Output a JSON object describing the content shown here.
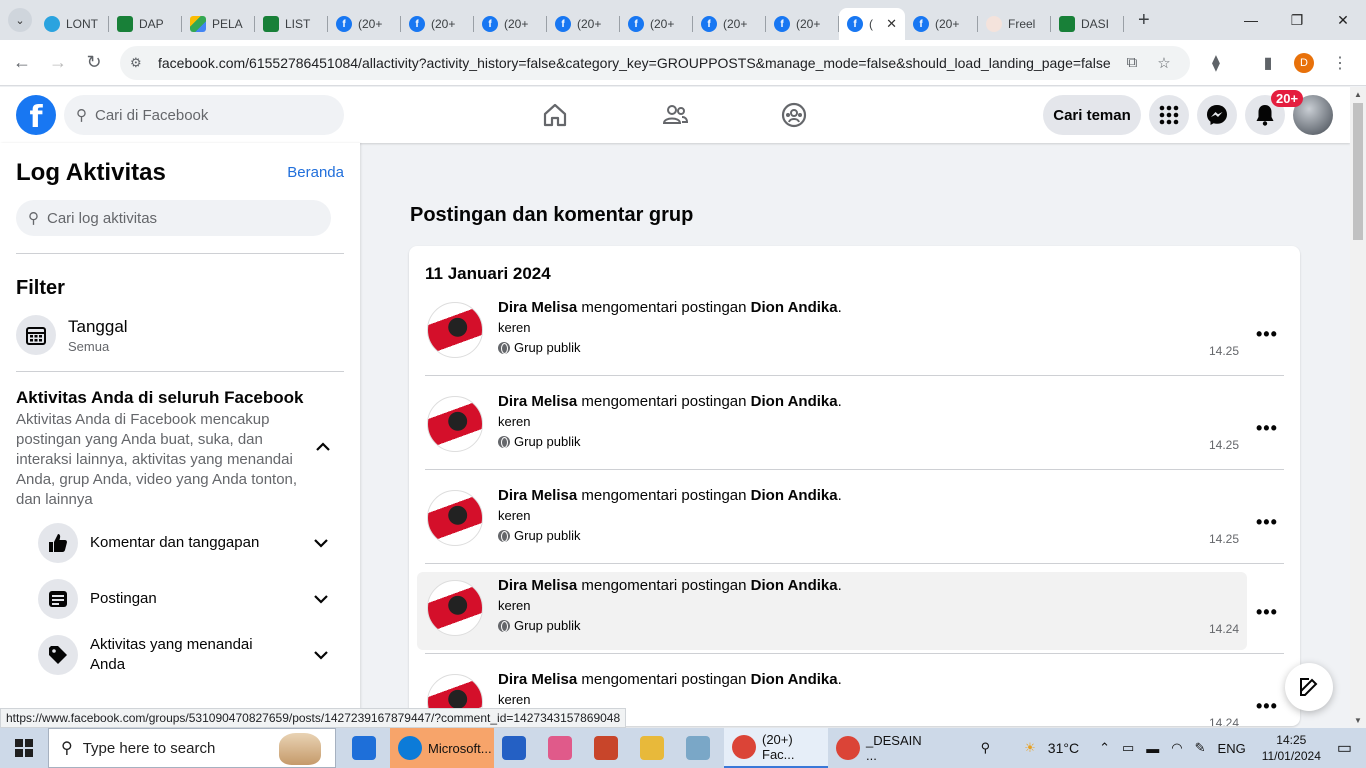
{
  "browser": {
    "tabs": [
      {
        "label": "LONT",
        "fav": "tg",
        "icon": "telegram-icon"
      },
      {
        "label": "DAP",
        "fav": "sh",
        "icon": "sheets-icon"
      },
      {
        "label": "PELA",
        "fav": "dr",
        "icon": "drive-icon"
      },
      {
        "label": "LIST",
        "fav": "sh",
        "icon": "sheets-icon"
      },
      {
        "label": "(20+",
        "fav": "fb",
        "icon": "facebook-icon"
      },
      {
        "label": "(20+",
        "fav": "fb",
        "icon": "facebook-icon"
      },
      {
        "label": "(20+",
        "fav": "fb",
        "icon": "facebook-icon"
      },
      {
        "label": "(20+",
        "fav": "fb",
        "icon": "facebook-icon"
      },
      {
        "label": "(20+",
        "fav": "fb",
        "icon": "facebook-icon"
      },
      {
        "label": "(20+",
        "fav": "fb",
        "icon": "facebook-icon"
      },
      {
        "label": "(20+",
        "fav": "fb",
        "icon": "facebook-icon"
      },
      {
        "label": "(",
        "fav": "fb",
        "icon": "facebook-icon",
        "active": true
      },
      {
        "label": "(20+",
        "fav": "fb",
        "icon": "facebook-icon"
      },
      {
        "label": "Freel",
        "fav": "fr",
        "icon": "freelance-icon"
      },
      {
        "label": "DASI",
        "fav": "sh",
        "icon": "sheets-icon"
      }
    ],
    "url": "facebook.com/61552786451084/allactivity?activity_history=false&category_key=GROUPPOSTS&manage_mode=false&should_load_landing_page=false",
    "profile_initial": "D",
    "status_url": "https://www.facebook.com/groups/531090470827659/posts/1427239167879447/?comment_id=1427343157869048"
  },
  "fbnav": {
    "search_placeholder": "Cari di Facebook",
    "find_friends": "Cari teman",
    "notif_badge": "20+"
  },
  "sidebar": {
    "title": "Log Aktivitas",
    "home_link": "Beranda",
    "search_placeholder": "Cari log aktivitas",
    "filter_title": "Filter",
    "filter_item": {
      "label": "Tanggal",
      "sub": "Semua"
    },
    "activity_title": "Aktivitas Anda di seluruh Facebook",
    "activity_desc": "Aktivitas Anda di Facebook mencakup postingan yang Anda buat, suka, dan interaksi lainnya, aktivitas yang menandai Anda, grup Anda, video yang Anda tonton, dan lainnya",
    "categories": [
      {
        "label": "Komentar dan tanggapan",
        "icon": "like-icon"
      },
      {
        "label": "Postingan",
        "icon": "post-icon"
      },
      {
        "label": "Aktivitas yang menandai Anda",
        "icon": "tag-icon"
      }
    ]
  },
  "main": {
    "title": "Postingan dan komentar grup",
    "date": "11 Januari 2024",
    "entries": [
      {
        "actor": "Dira Melisa",
        "verb": " mengomentari postingan ",
        "target": "Dion Andika",
        "end": ".",
        "comment": "keren",
        "audience": "Grup publik",
        "time": "14.25"
      },
      {
        "actor": "Dira Melisa",
        "verb": " mengomentari postingan ",
        "target": "Dion Andika",
        "end": ".",
        "comment": "keren",
        "audience": "Grup publik",
        "time": "14.25"
      },
      {
        "actor": "Dira Melisa",
        "verb": " mengomentari postingan ",
        "target": "Dion Andika",
        "end": ".",
        "comment": "keren",
        "audience": "Grup publik",
        "time": "14.25"
      },
      {
        "actor": "Dira Melisa",
        "verb": " mengomentari postingan ",
        "target": "Dion Andika",
        "end": ".",
        "comment": "keren",
        "audience": "Grup publik",
        "time": "14.24"
      },
      {
        "actor": "Dira Melisa",
        "verb": " mengomentari postingan ",
        "target": "Dion Andika",
        "end": ".",
        "comment": "keren",
        "audience": "",
        "time": "14.24"
      }
    ]
  },
  "taskbar": {
    "search_placeholder": "Type here to search",
    "apps": [
      {
        "label": "",
        "icon": "mail-icon",
        "color": "#1e6fd9"
      },
      {
        "label": "Microsoft...",
        "icon": "edge-icon",
        "color": "#0c7bd8",
        "edge": true
      },
      {
        "label": "",
        "icon": "store-icon",
        "color": "#2460c4"
      },
      {
        "label": "",
        "icon": "snipping-icon",
        "color": "#e05a8a"
      },
      {
        "label": "",
        "icon": "powerpoint-icon",
        "color": "#c8452a"
      },
      {
        "label": "",
        "icon": "explorer-icon",
        "color": "#e8b93a"
      },
      {
        "label": "",
        "icon": "app-icon",
        "color": "#7aa7c7"
      },
      {
        "label": "(20+) Fac...",
        "icon": "chrome-icon",
        "color": "#db4437",
        "active": true
      },
      {
        "label": "_DESAIN ...",
        "icon": "chrome-icon",
        "color": "#db4437"
      }
    ],
    "temperature": "31°C",
    "lang": "ENG",
    "time": "14:25",
    "date": "11/01/2024"
  }
}
